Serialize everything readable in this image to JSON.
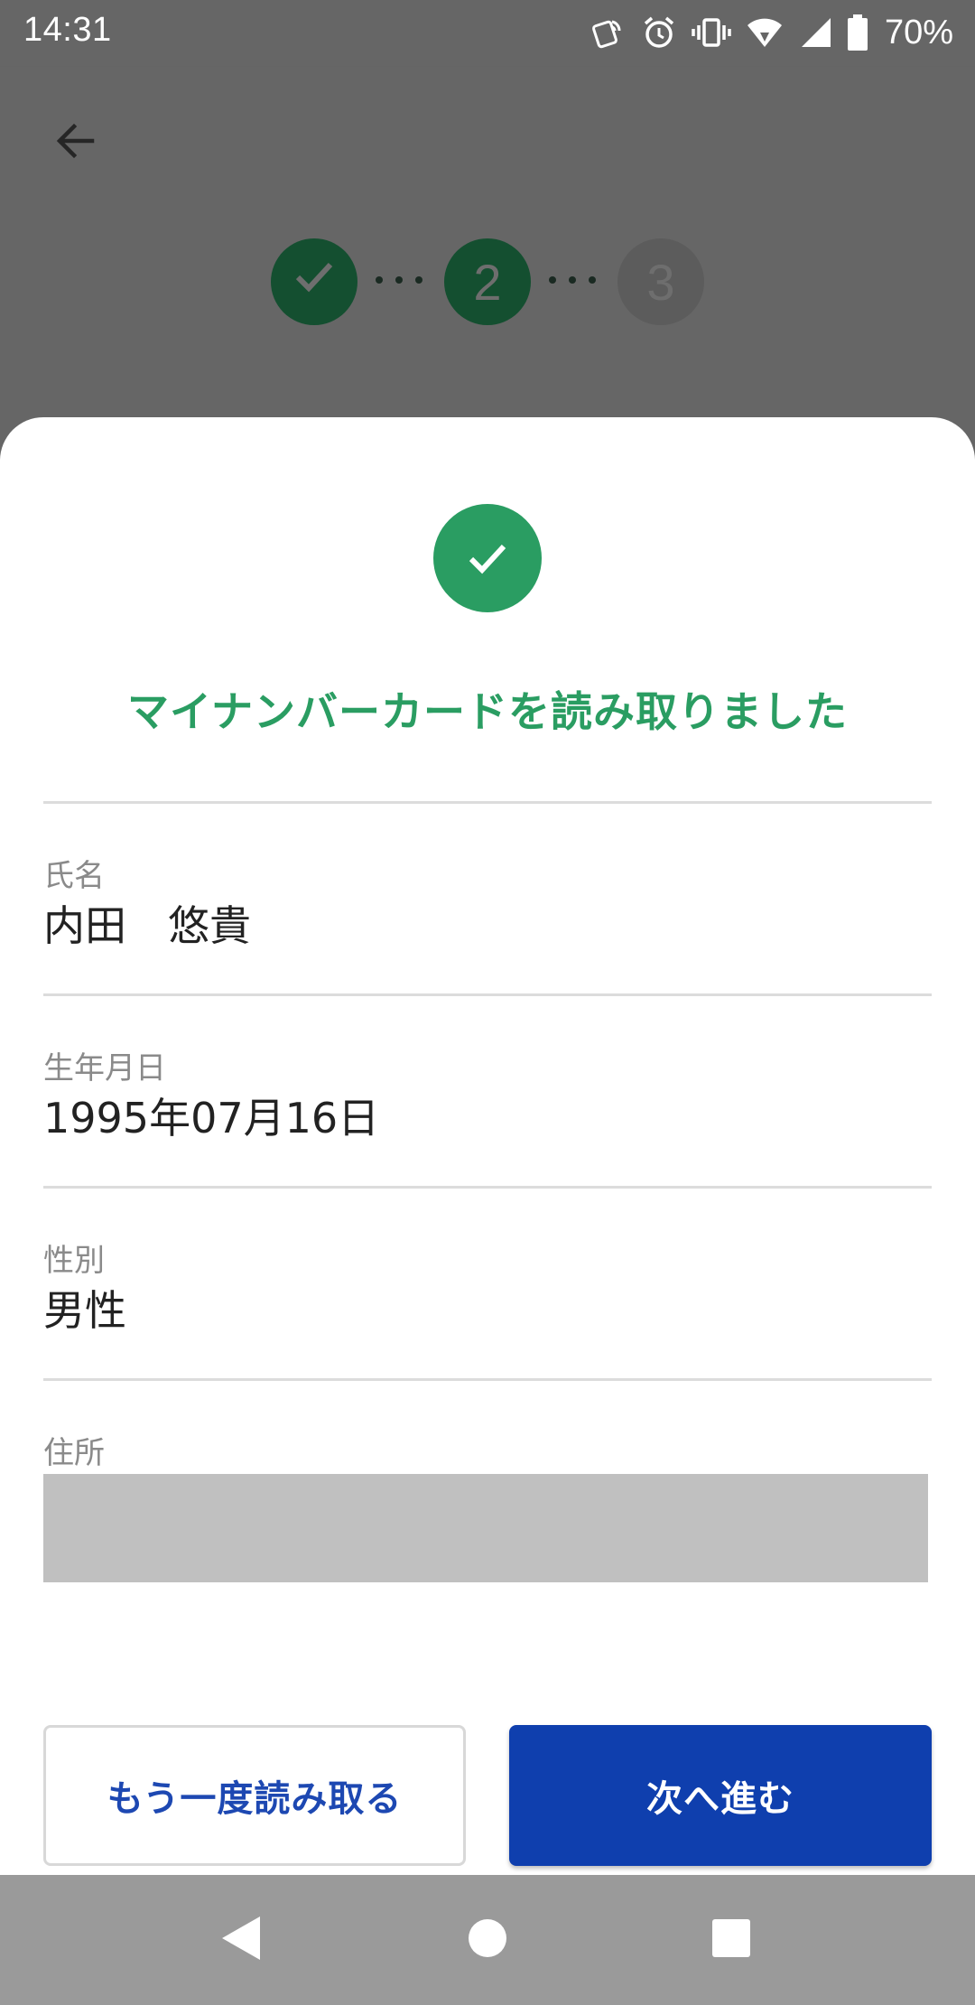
{
  "status_bar": {
    "time": "14:31",
    "battery_percent": "70%",
    "icons": [
      "nfc-icon",
      "alarm-icon",
      "vibrate-icon",
      "wifi-icon",
      "cellular-signal-icon",
      "battery-icon"
    ]
  },
  "app_bar": {
    "back_icon": "arrow-back-icon"
  },
  "stepper": {
    "steps": [
      {
        "state": "done",
        "label": ""
      },
      {
        "state": "current",
        "label": "2"
      },
      {
        "state": "pending",
        "label": "3"
      }
    ]
  },
  "sheet": {
    "title": "マイナンバーカードを読み取りました",
    "success_icon": "check-circle-icon",
    "fields": [
      {
        "label": "氏名",
        "value": "内田　悠貴"
      },
      {
        "label": "生年月日",
        "value": "1995年07月16日"
      },
      {
        "label": "性別",
        "value": "男性"
      },
      {
        "label": "住所",
        "value": null
      }
    ],
    "retry_button": "もう一度読み取る",
    "next_button": "次へ進む"
  },
  "nav_bar": {
    "icons": [
      "nav-back-icon",
      "nav-home-icon",
      "nav-recents-icon"
    ]
  },
  "colors": {
    "success_green": "#2a9d62",
    "primary_blue": "#0f3fae",
    "overlay_gray": "#666666"
  }
}
